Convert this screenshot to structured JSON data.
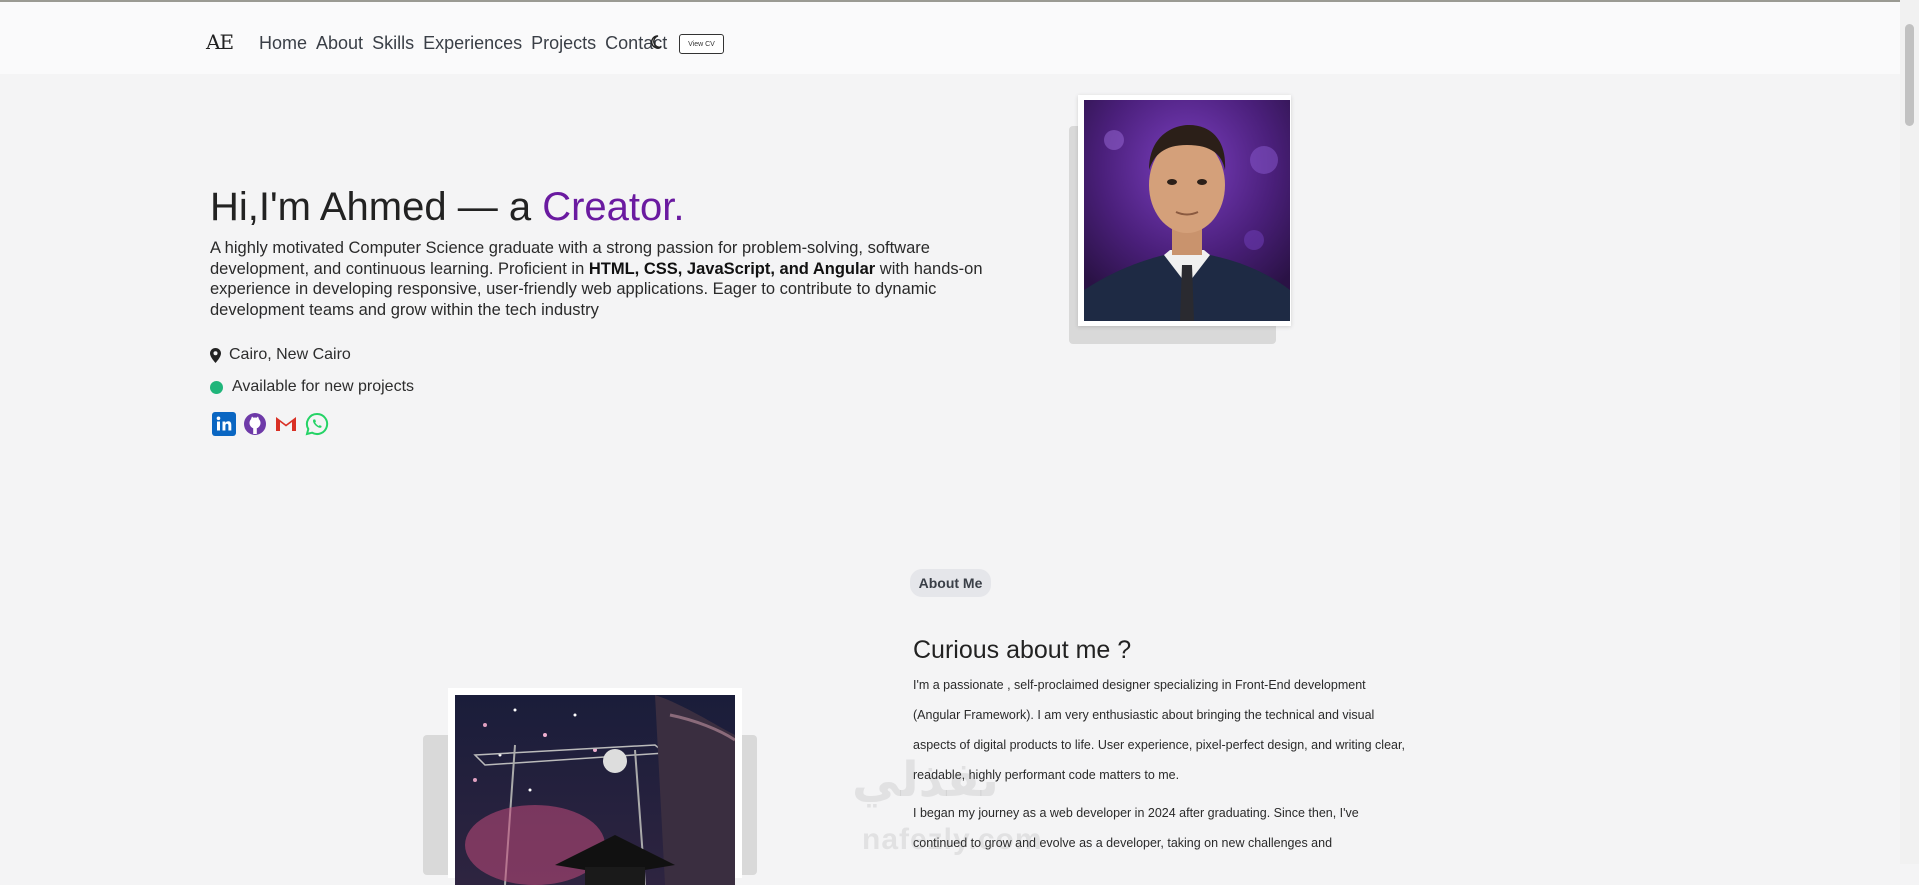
{
  "header": {
    "logo": "AE",
    "nav": [
      "Home",
      "About",
      "Skills",
      "Experiences",
      "Projects",
      "Contact"
    ],
    "theme_icon": "moon-icon",
    "cv_label": "View CV"
  },
  "hero": {
    "title_prefix": "Hi,I'm Ahmed — a ",
    "title_accent": "Creator.",
    "desc_part1": "A highly motivated Computer Science graduate with a strong passion for problem-solving, software development, and continuous learning. Proficient in ",
    "desc_bold": "HTML, CSS, JavaScript, and Angular",
    "desc_part2": " with hands-on experience in developing responsive, user-friendly web applications. Eager to contribute to dynamic development teams and grow within the tech industry",
    "location": "Cairo, New Cairo",
    "availability": "Available for new projects",
    "socials": [
      "linkedin-icon",
      "github-icon",
      "gmail-icon",
      "whatsapp-icon"
    ]
  },
  "about": {
    "badge": "About Me",
    "title": "Curious about me ?",
    "para1": "I'm a passionate , self-proclaimed designer specializing in Front-End development (Angular Framework). I am very enthusiastic about bringing the technical and visual aspects of digital products to life. User experience, pixel-perfect design, and writing clear, readable, highly performant code matters to me.",
    "para2": "I began my journey as a web developer in 2024 after graduating. Since then, I've continued to grow and evolve as a developer, taking on new challenges and"
  },
  "colors": {
    "accent": "#6a1aa0",
    "status_green": "#1fb57a",
    "linkedin": "#0a66c2",
    "github": "#6e3aa8",
    "gmail": "#d93025",
    "whatsapp": "#25d366"
  }
}
